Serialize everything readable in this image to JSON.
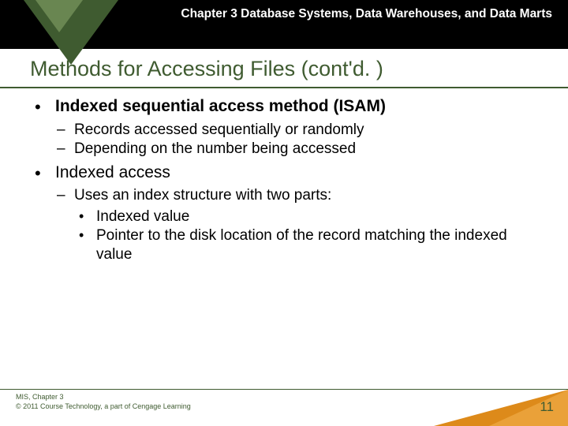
{
  "header": {
    "chapter_title": "Chapter 3 Database Systems, Data Warehouses, and Data Marts"
  },
  "title": "Methods for Accessing Files (cont'd. )",
  "bullets": {
    "b1": "Indexed sequential access method (ISAM)",
    "b1a": "Records accessed sequentially or randomly",
    "b1b": "Depending on the number being accessed",
    "b2": "Indexed access",
    "b2a": "Uses an index structure with two parts:",
    "b2a1": "Indexed value",
    "b2a2": "Pointer to the disk location of the record matching the indexed value"
  },
  "footer": {
    "line1": "MIS, Chapter 3",
    "line2": "© 2011 Course Technology, a part of Cengage Learning",
    "page": "11"
  }
}
